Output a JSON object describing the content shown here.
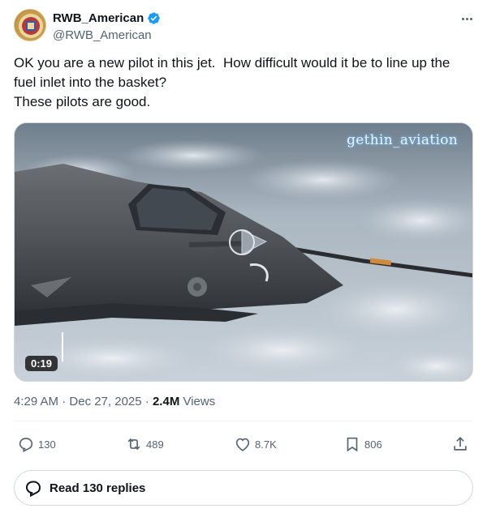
{
  "author": {
    "display_name": "RWB_American",
    "handle": "@RWB_American",
    "verified": true,
    "verified_color": "#1d9bf0"
  },
  "more_icon": "more-horizontal-icon",
  "tweet": {
    "text": "OK you are a new pilot in this jet.  How difficult would it be to line up the fuel inlet into the basket?\nThese pilots are good."
  },
  "media": {
    "watermark": "gethin_aviation",
    "duration": "0:19",
    "icon": "video-thumbnail"
  },
  "meta": {
    "time": "4:29 AM",
    "separator": " · ",
    "date": "Dec 27, 2025",
    "separator2": " · ",
    "views_count": "2.4M",
    "views_label": " Views"
  },
  "actions": {
    "reply": {
      "icon": "reply-icon",
      "count": "130"
    },
    "repost": {
      "icon": "repost-icon",
      "count": "489"
    },
    "like": {
      "icon": "heart-icon",
      "count": "8.7K"
    },
    "bookmark": {
      "icon": "bookmark-icon",
      "count": "806"
    },
    "share": {
      "icon": "share-icon"
    }
  },
  "read_replies": {
    "label": "Read 130 replies",
    "icon": "speech-bubble-icon"
  },
  "colors": {
    "text_primary": "#0f1419",
    "text_secondary": "#536471",
    "border": "#cfd9de",
    "accent": "#1d9bf0"
  }
}
